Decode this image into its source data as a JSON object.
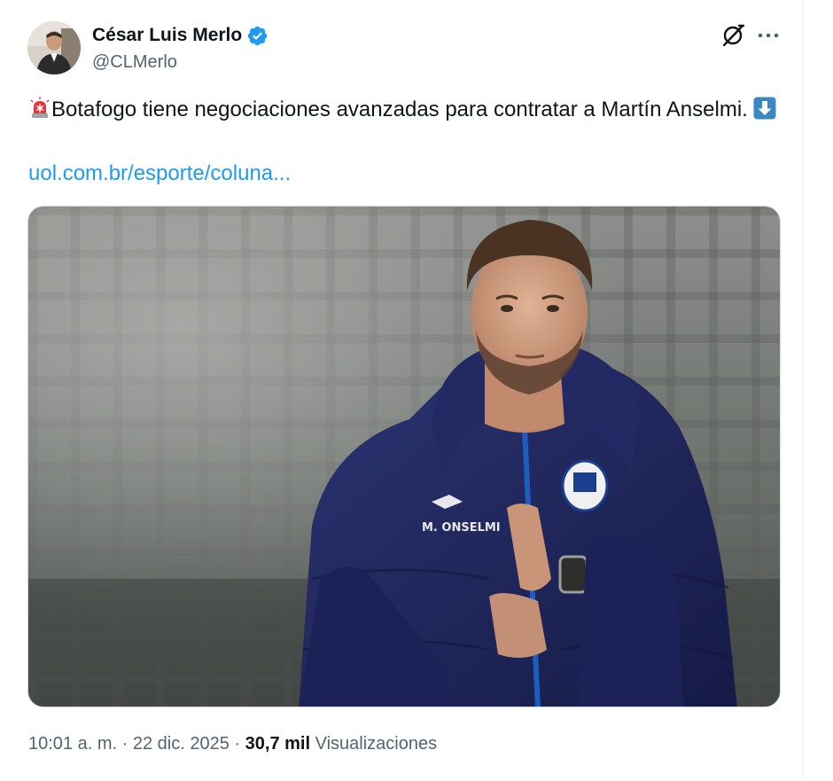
{
  "author": {
    "display_name": "César Luis Merlo",
    "handle": "@CLMerlo",
    "verified": true
  },
  "tweet": {
    "text_line": "Botafogo tiene negociaciones avanzadas para contratar a Martín Anselmi.",
    "link_text": "uol.com.br/esporte/coluna...",
    "emoji_start": "siren-icon",
    "emoji_end": "down-arrow-icon"
  },
  "media": {
    "alt_text": "Image",
    "jacket_text": "M. ONSELMI"
  },
  "meta": {
    "time": "10:01 a. m.",
    "separator": "·",
    "date": "22 dic. 2025",
    "views_count": "30,7 mil",
    "views_label": "Visualizaciones"
  },
  "colors": {
    "link": "#1d9bf0",
    "verified": "#1d9bf0",
    "secondary_text": "#536471",
    "primary_text": "#0f1419"
  },
  "icons": [
    "verified-badge-icon",
    "grok-icon",
    "more-icon",
    "siren-icon",
    "down-arrow-icon"
  ]
}
